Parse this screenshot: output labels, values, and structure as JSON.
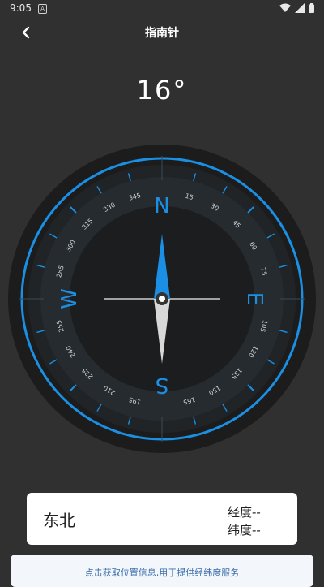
{
  "status_bar": {
    "time": "9:05",
    "notification_letter": "A"
  },
  "header": {
    "title": "指南针",
    "back_icon": "chevron-left-icon"
  },
  "heading": {
    "degrees": 16,
    "display": "16°"
  },
  "compass": {
    "accent_color": "#1a8fe3",
    "cardinals": {
      "n": "N",
      "e": "E",
      "s": "S",
      "w": "W"
    },
    "degree_labels": [
      "15",
      "30",
      "45",
      "60",
      "75",
      "105",
      "120",
      "135",
      "150",
      "165",
      "195",
      "210",
      "225",
      "240",
      "255",
      "285",
      "300",
      "315",
      "330",
      "345"
    ]
  },
  "info": {
    "direction": "东北",
    "longitude": "经度--",
    "latitude": "纬度--"
  },
  "location_prompt": {
    "text": "点击获取位置信息,用于提供经纬度服务"
  }
}
